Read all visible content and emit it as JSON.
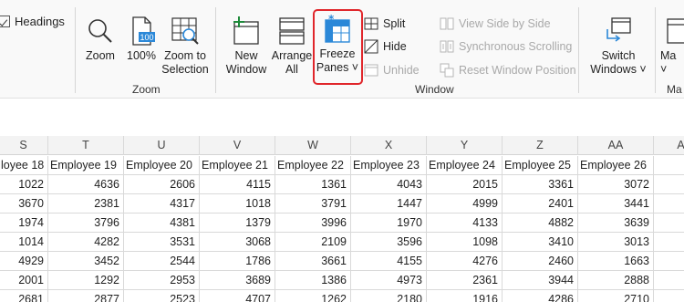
{
  "ribbon": {
    "headings_label": "Headings",
    "zoom_group": {
      "label": "Zoom",
      "zoom": "Zoom",
      "pct100": "100%",
      "pct_icon_text": "100",
      "zoom_sel_l1": "Zoom to",
      "zoom_sel_l2": "Selection"
    },
    "window_group": {
      "label": "Window",
      "new_window_l1": "New",
      "new_window_l2": "Window",
      "arrange_l1": "Arrange",
      "arrange_l2": "All",
      "freeze_l1": "Freeze",
      "freeze_l2": "Panes ˅",
      "split": "Split",
      "hide": "Hide",
      "unhide": "Unhide",
      "view_side": "View Side by Side",
      "sync_scroll": "Synchronous Scrolling",
      "reset_pos": "Reset Window Position",
      "switch_l1": "Switch",
      "switch_l2": "Windows ˅"
    },
    "macros_l1": "Ma",
    "macros_l2": "˅",
    "macros_group": "Ma"
  },
  "grid": {
    "columns": [
      "S",
      "T",
      "U",
      "V",
      "W",
      "X",
      "Y",
      "Z",
      "AA",
      "A"
    ],
    "header_row": [
      "loyee 18",
      "Employee 19",
      "Employee 20",
      "Employee 21",
      "Employee 22",
      "Employee 23",
      "Employee 24",
      "Employee 25",
      "Employee 26",
      ""
    ],
    "rows": [
      [
        "1022",
        "4636",
        "2606",
        "4115",
        "1361",
        "4043",
        "2015",
        "3361",
        "3072",
        ""
      ],
      [
        "3670",
        "2381",
        "4317",
        "1018",
        "3791",
        "1447",
        "4999",
        "2401",
        "3441",
        ""
      ],
      [
        "1974",
        "3796",
        "4381",
        "1379",
        "3996",
        "1970",
        "4133",
        "4882",
        "3639",
        ""
      ],
      [
        "1014",
        "4282",
        "3531",
        "3068",
        "2109",
        "3596",
        "1098",
        "3410",
        "3013",
        ""
      ],
      [
        "4929",
        "3452",
        "2544",
        "1786",
        "3661",
        "4155",
        "4276",
        "2460",
        "1663",
        ""
      ],
      [
        "2001",
        "1292",
        "2953",
        "3689",
        "1386",
        "4973",
        "2361",
        "3944",
        "2888",
        ""
      ],
      [
        "2681",
        "2877",
        "2523",
        "4707",
        "1262",
        "2180",
        "1916",
        "4286",
        "2710",
        ""
      ]
    ]
  },
  "colors": {
    "highlight": "#e0262b",
    "accent": "#2b88d8",
    "green": "#1e8a3a"
  }
}
